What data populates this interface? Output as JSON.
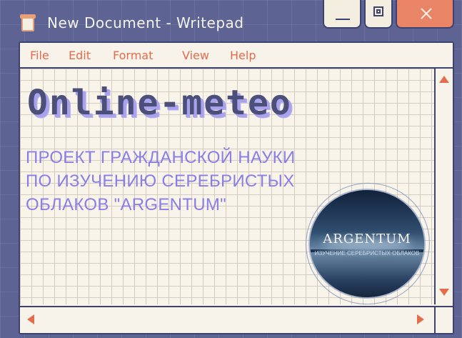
{
  "window": {
    "title": "New Document - Writepad"
  },
  "menu": {
    "items": [
      "File",
      "Edit",
      "Format",
      "View",
      "Help"
    ]
  },
  "document": {
    "heading": "Online-meteo",
    "subtitle_lines": [
      "ПРОЕКТ ГРАЖДАНСКОЙ НАУКИ",
      "ПО ИЗУЧЕНИЮ СЕРЕБРИСТЫХ",
      "ОБЛАКОВ \"ARGENTUM\""
    ]
  },
  "logo": {
    "title": "ARGENTUM",
    "caption": "ИЗУЧЕНИЕ СЕРЕБРИСТЫХ ОБЛАКОВ"
  },
  "colors": {
    "background": "#5d6493",
    "accent": "#e36c4c",
    "heading_shadow": "#a9a3ee",
    "subtitle": "#8a7ee6",
    "close_button": "#ea8466"
  }
}
